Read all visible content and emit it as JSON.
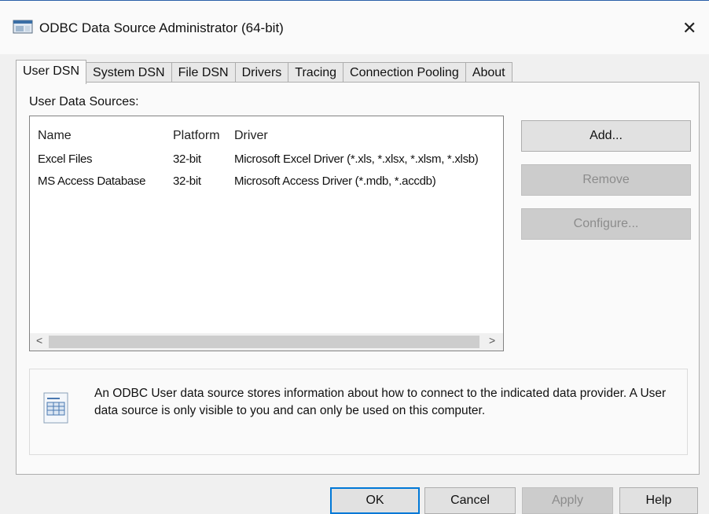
{
  "window": {
    "title": "ODBC Data Source Administrator (64-bit)",
    "close_glyph": "✕",
    "icon": "app-window-icon"
  },
  "tabs": [
    {
      "label": "User DSN",
      "active": true
    },
    {
      "label": "System DSN"
    },
    {
      "label": "File DSN"
    },
    {
      "label": "Drivers"
    },
    {
      "label": "Tracing"
    },
    {
      "label": "Connection Pooling"
    },
    {
      "label": "About"
    }
  ],
  "user_dsn": {
    "group_label": "User Data Sources:",
    "columns": {
      "name": "Name",
      "platform": "Platform",
      "driver": "Driver"
    },
    "rows": [
      {
        "name": "Excel Files",
        "platform": "32-bit",
        "driver": "Microsoft Excel Driver (*.xls, *.xlsx, *.xlsm, *.xlsb)"
      },
      {
        "name": "MS Access Database",
        "platform": "32-bit",
        "driver": "Microsoft Access Driver (*.mdb, *.accdb)"
      }
    ],
    "scroll_left": "<",
    "scroll_right": ">",
    "buttons": {
      "add": "Add...",
      "remove": "Remove",
      "configure": "Configure..."
    },
    "info_text": "An ODBC User data source stores information about how to connect to the indicated data provider.  A User data source is only visible to you and can only be used on this computer."
  },
  "footer": {
    "ok": "OK",
    "cancel": "Cancel",
    "apply": "Apply",
    "help": "Help"
  }
}
